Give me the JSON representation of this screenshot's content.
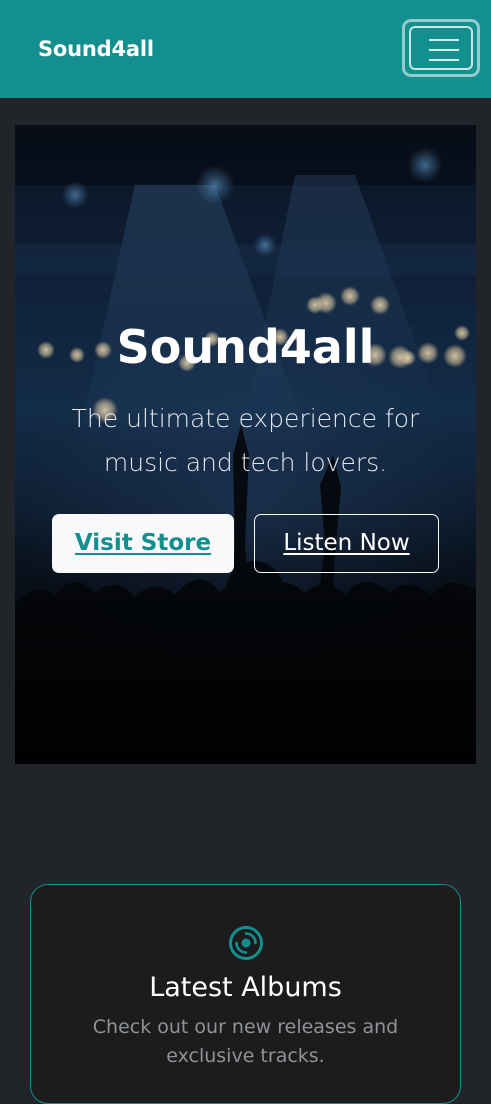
{
  "navbar": {
    "brand": "Sound4all",
    "toggle_icon": "hamburger-menu-icon",
    "background": "#148f8f"
  },
  "hero": {
    "title": "Sound4all",
    "lead": "The ultimate experience for music and tech lovers.",
    "buttons": {
      "visit_store": "Visit Store",
      "listen_now": "Listen Now"
    },
    "background_image": "concert crowd with raised hands and stage lights"
  },
  "features": {
    "card": {
      "icon": "disc-icon",
      "title": "Latest Albums",
      "text": "Check out our new releases and exclusive tracks."
    }
  },
  "colors": {
    "accent": "#148f8f",
    "page_background": "#212529",
    "card_background": "#1c1c1d",
    "muted_text": "#8e9399"
  }
}
